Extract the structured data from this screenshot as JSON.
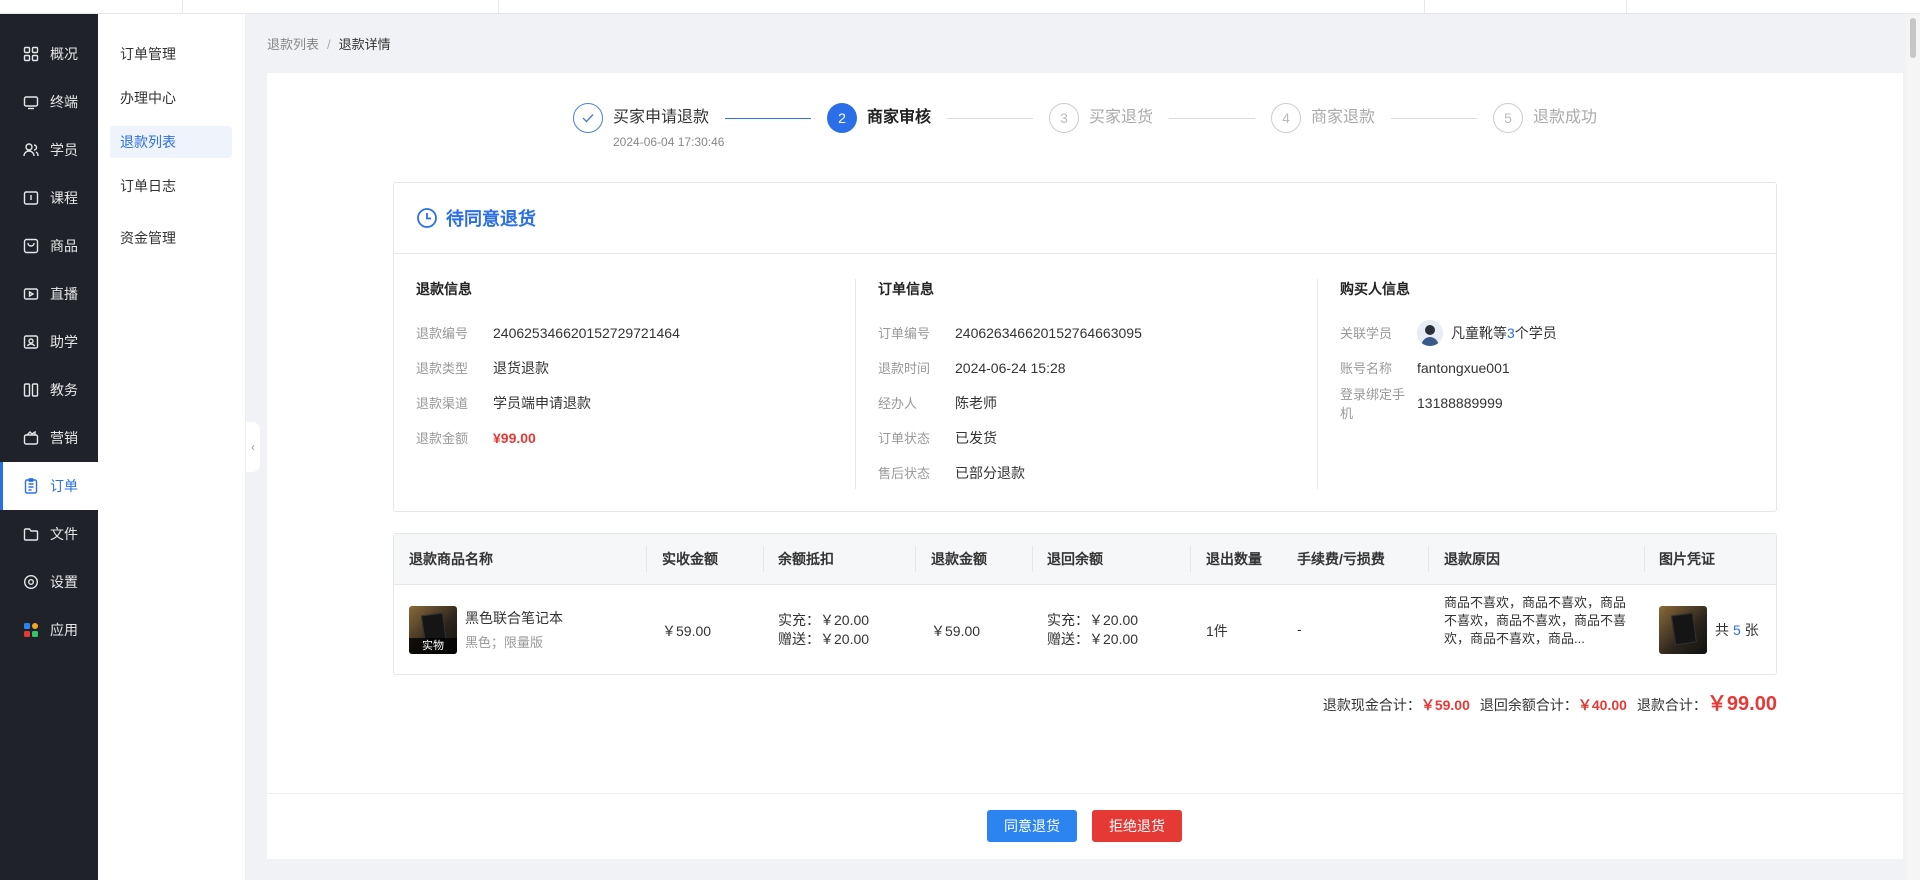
{
  "sidebar": {
    "items": [
      {
        "label": "概况",
        "icon": "grid-icon"
      },
      {
        "label": "终端",
        "icon": "terminal-icon"
      },
      {
        "label": "学员",
        "icon": "users-icon"
      },
      {
        "label": "课程",
        "icon": "course-icon"
      },
      {
        "label": "商品",
        "icon": "goods-icon"
      },
      {
        "label": "直播",
        "icon": "live-icon"
      },
      {
        "label": "助学",
        "icon": "assist-icon"
      },
      {
        "label": "教务",
        "icon": "book-icon"
      },
      {
        "label": "营销",
        "icon": "marketing-icon"
      },
      {
        "label": "订单",
        "icon": "order-icon"
      },
      {
        "label": "文件",
        "icon": "folder-icon"
      },
      {
        "label": "设置",
        "icon": "settings-icon"
      },
      {
        "label": "应用",
        "icon": "apps-icon"
      }
    ]
  },
  "submenu": {
    "items": [
      "订单管理",
      "办理中心",
      "退款列表",
      "订单日志",
      "资金管理"
    ]
  },
  "breadcrumb": {
    "parent": "退款列表",
    "sep": "/",
    "current": "退款详情"
  },
  "steps": [
    {
      "num": "✓",
      "label": "买家申请退款",
      "time": "2024-06-04 17:30:46"
    },
    {
      "num": "2",
      "label": "商家审核"
    },
    {
      "num": "3",
      "label": "买家退货"
    },
    {
      "num": "4",
      "label": "商家退款"
    },
    {
      "num": "5",
      "label": "退款成功"
    }
  ],
  "status": {
    "title": "待同意退货"
  },
  "refund_info": {
    "title": "退款信息",
    "rows": [
      {
        "k": "退款编号",
        "v": "240625346620152729721464"
      },
      {
        "k": "退款类型",
        "v": "退货退款"
      },
      {
        "k": "退款渠道",
        "v": "学员端申请退款"
      },
      {
        "k": "退款金额",
        "v": "¥99.00"
      }
    ]
  },
  "order_info": {
    "title": "订单信息",
    "rows": [
      {
        "k": "订单编号",
        "v": "240626346620152764663095"
      },
      {
        "k": "退款时间",
        "v": "2024-06-24 15:28"
      },
      {
        "k": "经办人",
        "v": "陈老师"
      },
      {
        "k": "订单状态",
        "v": "已发货"
      },
      {
        "k": "售后状态",
        "v": "已部分退款"
      }
    ]
  },
  "buyer_info": {
    "title": "购买人信息",
    "student_label": "关联学员",
    "student_name": "凡童靴",
    "student_more_pre": "等",
    "student_count": "3",
    "student_more_post": "个学员",
    "rows": [
      {
        "k": "账号名称",
        "v": "fantongxue001"
      },
      {
        "k": "登录绑定手机",
        "v": "13188889999"
      }
    ]
  },
  "table": {
    "headers": [
      "退款商品名称",
      "实收金额",
      "余额抵扣",
      "退款金额",
      "退回余额",
      "退出数量",
      "手续费/亏损费",
      "退款原因",
      "图片凭证"
    ],
    "row": {
      "name": "黑色联合笔记本",
      "spec": "黑色；限量版",
      "tag": "实物",
      "received": "￥59.00",
      "balance_line1": "实充：￥20.00",
      "balance_line2": "赠送：￥20.00",
      "refund": "￥59.00",
      "return_line1": "实充：￥20.00",
      "return_line2": "赠送：￥20.00",
      "qty": "1件",
      "fee": "-",
      "reason": "商品不喜欢，商品不喜欢，商品不喜欢，商品不喜欢，商品不喜欢，商品不喜欢，商品...",
      "img_pre": "共",
      "img_count": "5",
      "img_post": "张"
    }
  },
  "totals": {
    "cash_label": "退款现金合计：",
    "cash": "￥59.00",
    "balance_label": "退回余额合计：",
    "balance": "￥40.00",
    "total_label": "退款合计：",
    "total": "￥99.00"
  },
  "actions": {
    "agree": "同意退货",
    "reject": "拒绝退货"
  },
  "colors": {
    "primary": "#2b6fe8",
    "danger": "#e53935",
    "sidebar": "#1f2329"
  }
}
